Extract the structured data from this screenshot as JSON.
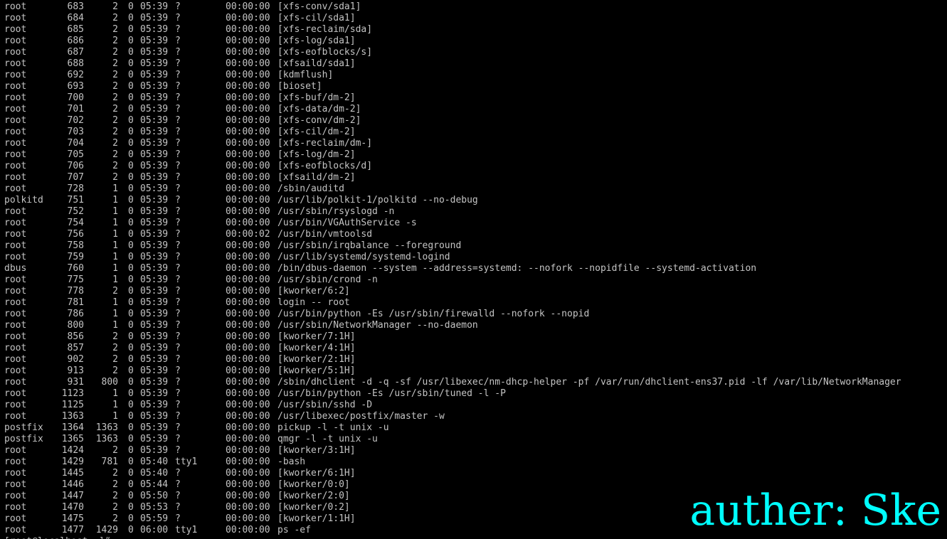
{
  "colors": {
    "background": "#000000",
    "text": "#c4c4c4",
    "watermark": "#00ffff"
  },
  "watermark": {
    "text": "auther: Ske"
  },
  "ps_rows": [
    {
      "uid": "root",
      "pid": "683",
      "ppid": "2",
      "c": "0",
      "stime": "05:39",
      "tty": "?",
      "time": "00:00:00",
      "cmd": "[xfs-conv/sda1]"
    },
    {
      "uid": "root",
      "pid": "684",
      "ppid": "2",
      "c": "0",
      "stime": "05:39",
      "tty": "?",
      "time": "00:00:00",
      "cmd": "[xfs-cil/sda1]"
    },
    {
      "uid": "root",
      "pid": "685",
      "ppid": "2",
      "c": "0",
      "stime": "05:39",
      "tty": "?",
      "time": "00:00:00",
      "cmd": "[xfs-reclaim/sda]"
    },
    {
      "uid": "root",
      "pid": "686",
      "ppid": "2",
      "c": "0",
      "stime": "05:39",
      "tty": "?",
      "time": "00:00:00",
      "cmd": "[xfs-log/sda1]"
    },
    {
      "uid": "root",
      "pid": "687",
      "ppid": "2",
      "c": "0",
      "stime": "05:39",
      "tty": "?",
      "time": "00:00:00",
      "cmd": "[xfs-eofblocks/s]"
    },
    {
      "uid": "root",
      "pid": "688",
      "ppid": "2",
      "c": "0",
      "stime": "05:39",
      "tty": "?",
      "time": "00:00:00",
      "cmd": "[xfsaild/sda1]"
    },
    {
      "uid": "root",
      "pid": "692",
      "ppid": "2",
      "c": "0",
      "stime": "05:39",
      "tty": "?",
      "time": "00:00:00",
      "cmd": "[kdmflush]"
    },
    {
      "uid": "root",
      "pid": "693",
      "ppid": "2",
      "c": "0",
      "stime": "05:39",
      "tty": "?",
      "time": "00:00:00",
      "cmd": "[bioset]"
    },
    {
      "uid": "root",
      "pid": "700",
      "ppid": "2",
      "c": "0",
      "stime": "05:39",
      "tty": "?",
      "time": "00:00:00",
      "cmd": "[xfs-buf/dm-2]"
    },
    {
      "uid": "root",
      "pid": "701",
      "ppid": "2",
      "c": "0",
      "stime": "05:39",
      "tty": "?",
      "time": "00:00:00",
      "cmd": "[xfs-data/dm-2]"
    },
    {
      "uid": "root",
      "pid": "702",
      "ppid": "2",
      "c": "0",
      "stime": "05:39",
      "tty": "?",
      "time": "00:00:00",
      "cmd": "[xfs-conv/dm-2]"
    },
    {
      "uid": "root",
      "pid": "703",
      "ppid": "2",
      "c": "0",
      "stime": "05:39",
      "tty": "?",
      "time": "00:00:00",
      "cmd": "[xfs-cil/dm-2]"
    },
    {
      "uid": "root",
      "pid": "704",
      "ppid": "2",
      "c": "0",
      "stime": "05:39",
      "tty": "?",
      "time": "00:00:00",
      "cmd": "[xfs-reclaim/dm-]"
    },
    {
      "uid": "root",
      "pid": "705",
      "ppid": "2",
      "c": "0",
      "stime": "05:39",
      "tty": "?",
      "time": "00:00:00",
      "cmd": "[xfs-log/dm-2]"
    },
    {
      "uid": "root",
      "pid": "706",
      "ppid": "2",
      "c": "0",
      "stime": "05:39",
      "tty": "?",
      "time": "00:00:00",
      "cmd": "[xfs-eofblocks/d]"
    },
    {
      "uid": "root",
      "pid": "707",
      "ppid": "2",
      "c": "0",
      "stime": "05:39",
      "tty": "?",
      "time": "00:00:00",
      "cmd": "[xfsaild/dm-2]"
    },
    {
      "uid": "root",
      "pid": "728",
      "ppid": "1",
      "c": "0",
      "stime": "05:39",
      "tty": "?",
      "time": "00:00:00",
      "cmd": "/sbin/auditd"
    },
    {
      "uid": "polkitd",
      "pid": "751",
      "ppid": "1",
      "c": "0",
      "stime": "05:39",
      "tty": "?",
      "time": "00:00:00",
      "cmd": "/usr/lib/polkit-1/polkitd --no-debug"
    },
    {
      "uid": "root",
      "pid": "752",
      "ppid": "1",
      "c": "0",
      "stime": "05:39",
      "tty": "?",
      "time": "00:00:00",
      "cmd": "/usr/sbin/rsyslogd -n"
    },
    {
      "uid": "root",
      "pid": "754",
      "ppid": "1",
      "c": "0",
      "stime": "05:39",
      "tty": "?",
      "time": "00:00:00",
      "cmd": "/usr/bin/VGAuthService -s"
    },
    {
      "uid": "root",
      "pid": "756",
      "ppid": "1",
      "c": "0",
      "stime": "05:39",
      "tty": "?",
      "time": "00:00:02",
      "cmd": "/usr/bin/vmtoolsd"
    },
    {
      "uid": "root",
      "pid": "758",
      "ppid": "1",
      "c": "0",
      "stime": "05:39",
      "tty": "?",
      "time": "00:00:00",
      "cmd": "/usr/sbin/irqbalance --foreground"
    },
    {
      "uid": "root",
      "pid": "759",
      "ppid": "1",
      "c": "0",
      "stime": "05:39",
      "tty": "?",
      "time": "00:00:00",
      "cmd": "/usr/lib/systemd/systemd-logind"
    },
    {
      "uid": "dbus",
      "pid": "760",
      "ppid": "1",
      "c": "0",
      "stime": "05:39",
      "tty": "?",
      "time": "00:00:00",
      "cmd": "/bin/dbus-daemon --system --address=systemd: --nofork --nopidfile --systemd-activation"
    },
    {
      "uid": "root",
      "pid": "775",
      "ppid": "1",
      "c": "0",
      "stime": "05:39",
      "tty": "?",
      "time": "00:00:00",
      "cmd": "/usr/sbin/crond -n"
    },
    {
      "uid": "root",
      "pid": "778",
      "ppid": "2",
      "c": "0",
      "stime": "05:39",
      "tty": "?",
      "time": "00:00:00",
      "cmd": "[kworker/6:2]"
    },
    {
      "uid": "root",
      "pid": "781",
      "ppid": "1",
      "c": "0",
      "stime": "05:39",
      "tty": "?",
      "time": "00:00:00",
      "cmd": "login -- root"
    },
    {
      "uid": "root",
      "pid": "786",
      "ppid": "1",
      "c": "0",
      "stime": "05:39",
      "tty": "?",
      "time": "00:00:00",
      "cmd": "/usr/bin/python -Es /usr/sbin/firewalld --nofork --nopid"
    },
    {
      "uid": "root",
      "pid": "800",
      "ppid": "1",
      "c": "0",
      "stime": "05:39",
      "tty": "?",
      "time": "00:00:00",
      "cmd": "/usr/sbin/NetworkManager --no-daemon"
    },
    {
      "uid": "root",
      "pid": "856",
      "ppid": "2",
      "c": "0",
      "stime": "05:39",
      "tty": "?",
      "time": "00:00:00",
      "cmd": "[kworker/7:1H]"
    },
    {
      "uid": "root",
      "pid": "857",
      "ppid": "2",
      "c": "0",
      "stime": "05:39",
      "tty": "?",
      "time": "00:00:00",
      "cmd": "[kworker/4:1H]"
    },
    {
      "uid": "root",
      "pid": "902",
      "ppid": "2",
      "c": "0",
      "stime": "05:39",
      "tty": "?",
      "time": "00:00:00",
      "cmd": "[kworker/2:1H]"
    },
    {
      "uid": "root",
      "pid": "913",
      "ppid": "2",
      "c": "0",
      "stime": "05:39",
      "tty": "?",
      "time": "00:00:00",
      "cmd": "[kworker/5:1H]"
    },
    {
      "uid": "root",
      "pid": "931",
      "ppid": "800",
      "c": "0",
      "stime": "05:39",
      "tty": "?",
      "time": "00:00:00",
      "cmd": "/sbin/dhclient -d -q -sf /usr/libexec/nm-dhcp-helper -pf /var/run/dhclient-ens37.pid -lf /var/lib/NetworkManager"
    },
    {
      "uid": "root",
      "pid": "1123",
      "ppid": "1",
      "c": "0",
      "stime": "05:39",
      "tty": "?",
      "time": "00:00:00",
      "cmd": "/usr/bin/python -Es /usr/sbin/tuned -l -P"
    },
    {
      "uid": "root",
      "pid": "1125",
      "ppid": "1",
      "c": "0",
      "stime": "05:39",
      "tty": "?",
      "time": "00:00:00",
      "cmd": "/usr/sbin/sshd -D"
    },
    {
      "uid": "root",
      "pid": "1363",
      "ppid": "1",
      "c": "0",
      "stime": "05:39",
      "tty": "?",
      "time": "00:00:00",
      "cmd": "/usr/libexec/postfix/master -w"
    },
    {
      "uid": "postfix",
      "pid": "1364",
      "ppid": "1363",
      "c": "0",
      "stime": "05:39",
      "tty": "?",
      "time": "00:00:00",
      "cmd": "pickup -l -t unix -u"
    },
    {
      "uid": "postfix",
      "pid": "1365",
      "ppid": "1363",
      "c": "0",
      "stime": "05:39",
      "tty": "?",
      "time": "00:00:00",
      "cmd": "qmgr -l -t unix -u"
    },
    {
      "uid": "root",
      "pid": "1424",
      "ppid": "2",
      "c": "0",
      "stime": "05:39",
      "tty": "?",
      "time": "00:00:00",
      "cmd": "[kworker/3:1H]"
    },
    {
      "uid": "root",
      "pid": "1429",
      "ppid": "781",
      "c": "0",
      "stime": "05:40",
      "tty": "tty1",
      "time": "00:00:00",
      "cmd": "-bash"
    },
    {
      "uid": "root",
      "pid": "1445",
      "ppid": "2",
      "c": "0",
      "stime": "05:40",
      "tty": "?",
      "time": "00:00:00",
      "cmd": "[kworker/6:1H]"
    },
    {
      "uid": "root",
      "pid": "1446",
      "ppid": "2",
      "c": "0",
      "stime": "05:44",
      "tty": "?",
      "time": "00:00:00",
      "cmd": "[kworker/0:0]"
    },
    {
      "uid": "root",
      "pid": "1447",
      "ppid": "2",
      "c": "0",
      "stime": "05:50",
      "tty": "?",
      "time": "00:00:00",
      "cmd": "[kworker/2:0]"
    },
    {
      "uid": "root",
      "pid": "1470",
      "ppid": "2",
      "c": "0",
      "stime": "05:53",
      "tty": "?",
      "time": "00:00:00",
      "cmd": "[kworker/0:2]"
    },
    {
      "uid": "root",
      "pid": "1475",
      "ppid": "2",
      "c": "0",
      "stime": "05:59",
      "tty": "?",
      "time": "00:00:00",
      "cmd": "[kworker/1:1H]"
    },
    {
      "uid": "root",
      "pid": "1477",
      "ppid": "1429",
      "c": "0",
      "stime": "06:00",
      "tty": "tty1",
      "time": "00:00:00",
      "cmd": "ps -ef"
    }
  ],
  "partial_prompt": {
    "text": "[root@localhost ~]#"
  }
}
